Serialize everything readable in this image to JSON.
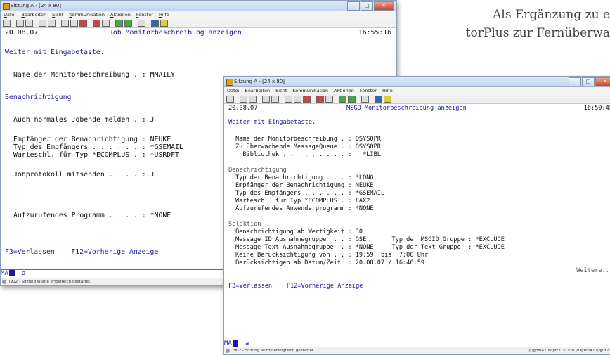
{
  "prose": {
    "line1": "Als Ergänzung zu e",
    "line2": "torPlus zur Fernüberwa"
  },
  "window1": {
    "title": "Sitzung A - [24 x 80]",
    "menu": [
      "Datei",
      "Bearbeiten",
      "Sicht",
      "Kommunikation",
      "Aktionen",
      "Fenster",
      "Hilfe"
    ],
    "date": "20.08.07",
    "heading": "Job Monitorbeschreibung anzeigen",
    "time": "16:55:16",
    "instruction": "Weiter mit Eingabetaste.",
    "monitor_name": "Name der Monitorbeschreibung . : MMAILY",
    "section_notify": "Benachrichtigung",
    "normal_end": "Auch normales Jobende melden . : J",
    "recipient": "Empfänger der Benachrichtigung : NEUKE",
    "recipient_type": "Typ des Empfängers . . . . . . : *GSEMAIL",
    "queue_type": "Warteschl. für Typ *ECOMPLUS . : *USRDFT",
    "joblog": "Jobprotokoll mitsenden . . . . : J",
    "program": "Aufzurufendes Programm . . . . : *NONE",
    "fkeys": "F3=Verlassen    F12=Vorherige Anzeige",
    "status_ma": "MA",
    "status_a": "a",
    "statusbar": "I902 - Sitzung wurde erfolgreich gestartet."
  },
  "window2": {
    "title": "Sitzung A - [24 x 80]",
    "menu": [
      "Datei",
      "Bearbeiten",
      "Sicht",
      "Kommunikation",
      "Aktionen",
      "Fenster",
      "Hilfe"
    ],
    "date": "20.08.07",
    "heading": "MSGQ Monitorbeschreibung anzeigen",
    "time": "16:50:45",
    "instruction": "Weiter mit Eingabetaste.",
    "monitor_name": "Name der Monitorbeschreibung . : QSYSOPR",
    "msgqueue": "Zu überwachende MessageQueue . : QSYSOPR",
    "library": "  Bibliothek . . . . . . . . . :   *LIBL",
    "section_notify": "Benachrichtigung",
    "notify_type": "Typ der Benachrichtigung . . . : *LONG",
    "recipient": "Empfänger der Benachrichtigung : NEUKE",
    "recipient_type": "Typ des Empfängers . . . . . . : *GSEMAIL",
    "queue_type": "Warteschl. für Typ *ECOMPLUS . : FAX2",
    "program": "Aufzurufendes Anwenderprogramm : *NONE",
    "section_select": "Selektion",
    "severity": "Benachrichtigung ab Wertigkeit : 30",
    "msgid_group": "Message ID Ausnahmegruppe  . . : GSE       Typ der MSGID Gruppe : *EXCLUDE",
    "msgtext_group": "Message Text Ausnahmegruppe  . : *NONE     Typ der Text Gruppe  : *EXCLUDE",
    "ignore_from": "Keine Berücksichtigung von . . : 19:59  bis  7:00 Uhr",
    "consider_from": "Berücksichtigen ab Datum/Zeit  : 20.08.07 / 16:46:59",
    "more": "Weitere...",
    "fkeys": "F3=Verlassen    F12=Vorherige Anzeige",
    "status_ma": "MA",
    "status_a": "a",
    "statusbar": "I902 - Sitzung wurde erfolgreich gestartet.",
    "statusbar_right": "\\\\Qgbln470\\qprt215I EIN \\\\Qgbln470\\qprt215I"
  }
}
